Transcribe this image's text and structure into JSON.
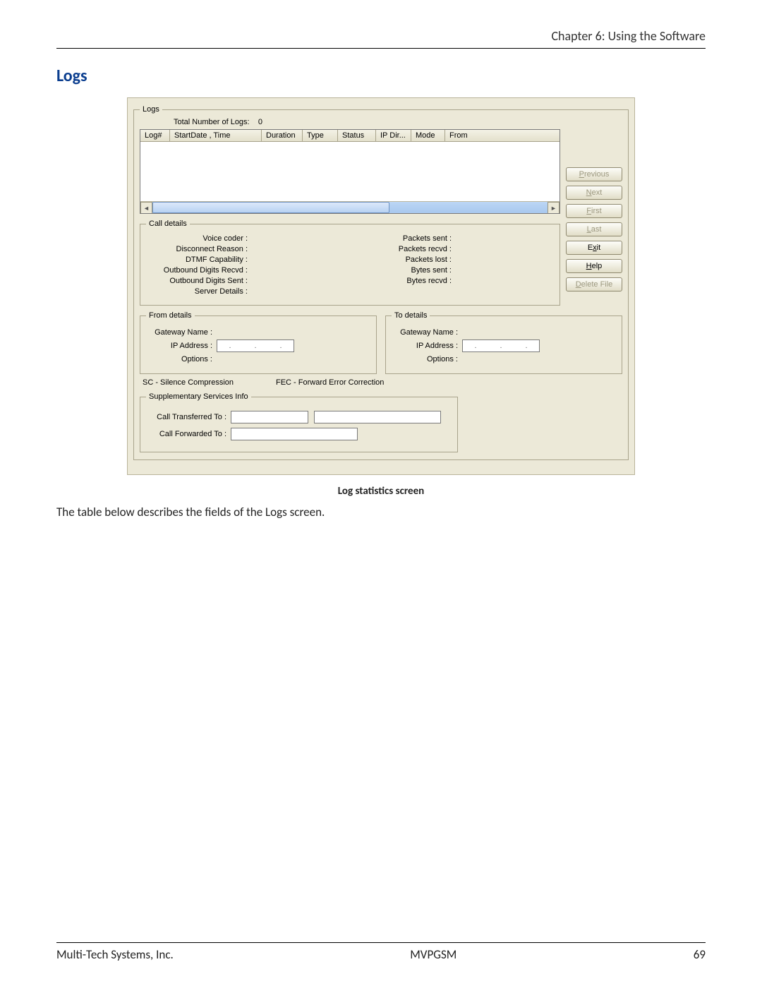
{
  "chapter_header": "Chapter 6: Using the Software",
  "section_title": "Logs",
  "caption": "Log statistics screen",
  "body_text": "The table below describes the fields of the Logs screen.",
  "footer": {
    "left": "Multi-Tech Systems, Inc.",
    "center": "MVPGSM",
    "right": "69"
  },
  "shot": {
    "logs_legend": "Logs",
    "total_label": "Total Number of Logs:",
    "total_value": "0",
    "columns": [
      "Log#",
      "StartDate , Time",
      "Duration",
      "Type",
      "Status",
      "IP Dir...",
      "Mode",
      "From"
    ],
    "buttons": {
      "previous": "Previous",
      "next": "Next",
      "first": "First",
      "last": "Last",
      "exit": "Exit",
      "help": "Help",
      "delete_file": "Delete File"
    },
    "call_details": {
      "legend": "Call details",
      "left": [
        "Voice coder :",
        "Disconnect Reason :",
        "DTMF Capability :",
        "Outbound Digits Recvd :",
        "Outbound Digits Sent :",
        "Server Details :"
      ],
      "right": [
        "Packets sent :",
        "Packets recvd :",
        "Packets lost :",
        "Bytes sent :",
        "Bytes recvd :"
      ]
    },
    "from_details": {
      "legend": "From details",
      "gateway": "Gateway Name :",
      "ip": "IP Address :",
      "options": "Options :"
    },
    "to_details": {
      "legend": "To details",
      "gateway": "Gateway Name :",
      "ip": "IP Address :",
      "options": "Options :"
    },
    "legend_sc": "SC - Silence Compression",
    "legend_fec": "FEC - Forward Error Correction",
    "sup": {
      "legend": "Supplementary Services Info",
      "transferred": "Call Transferred To :",
      "forwarded": "Call Forwarded To :"
    }
  }
}
